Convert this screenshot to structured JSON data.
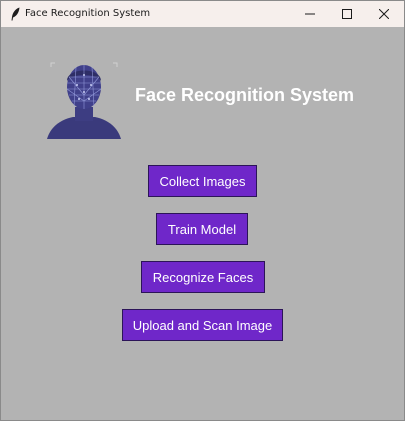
{
  "window": {
    "title": "Face Recognition System",
    "title_icon": "feather-icon",
    "controls": [
      "minimize-icon",
      "maximize-icon",
      "close-icon"
    ]
  },
  "header": {
    "heading": "Face Recognition System",
    "logo_icon": "face-mesh-icon"
  },
  "buttons": {
    "collect": "Collect Images",
    "train": "Train Model",
    "recognize": "Recognize Faces",
    "upload": "Upload and Scan Image"
  },
  "colors": {
    "background": "#b3b3b3",
    "button_bg": "#6f27c9",
    "button_text": "#ffffff",
    "heading_text": "#ffffff",
    "titlebar_bg": "#f6efec"
  }
}
